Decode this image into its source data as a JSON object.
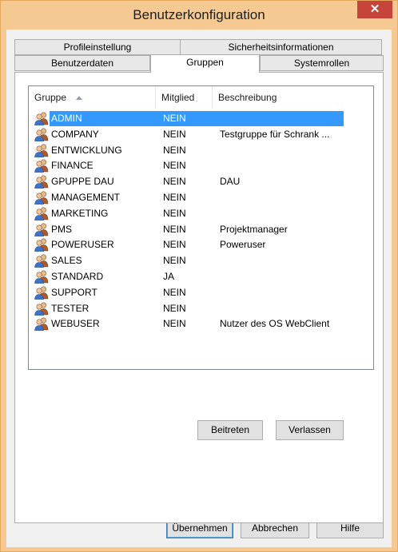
{
  "window": {
    "title": "Benutzerkonfiguration",
    "close_label": "✕"
  },
  "tabs": {
    "row_top": [
      "Profileinstellung",
      "Sicherheitsinformationen"
    ],
    "row_bottom": [
      "Benutzerdaten",
      "Gruppen",
      "Systemrollen"
    ],
    "active": "Gruppen"
  },
  "list": {
    "columns": [
      "Gruppe",
      "Mitglied",
      "Beschreibung"
    ],
    "sort_column": "Gruppe",
    "sort_direction": "ascending",
    "selected_row": "ADMIN",
    "rows": [
      {
        "name": "ADMIN",
        "member": "NEIN",
        "desc": ""
      },
      {
        "name": "COMPANY",
        "member": "NEIN",
        "desc": "Testgruppe für Schrank ..."
      },
      {
        "name": "ENTWICKLUNG",
        "member": "NEIN",
        "desc": ""
      },
      {
        "name": "FINANCE",
        "member": "NEIN",
        "desc": ""
      },
      {
        "name": "GPUPPE DAU",
        "member": "NEIN",
        "desc": "DAU"
      },
      {
        "name": "MANAGEMENT",
        "member": "NEIN",
        "desc": ""
      },
      {
        "name": "MARKETING",
        "member": "NEIN",
        "desc": ""
      },
      {
        "name": "PMS",
        "member": "NEIN",
        "desc": "Projektmanager"
      },
      {
        "name": "POWERUSER",
        "member": "NEIN",
        "desc": "Poweruser"
      },
      {
        "name": "SALES",
        "member": "NEIN",
        "desc": ""
      },
      {
        "name": "STANDARD",
        "member": "JA",
        "desc": ""
      },
      {
        "name": "SUPPORT",
        "member": "NEIN",
        "desc": ""
      },
      {
        "name": "TESTER",
        "member": "NEIN",
        "desc": ""
      },
      {
        "name": "WEBUSER",
        "member": "NEIN",
        "desc": "Nutzer des OS WebClient"
      }
    ],
    "row_icon": "user-group-icon"
  },
  "panel_buttons": {
    "join": "Beitreten",
    "leave": "Verlassen"
  },
  "dialog_buttons": {
    "ok": "Übernehmen",
    "cancel": "Abbrechen",
    "help": "Hilfe"
  },
  "colors": {
    "frame": "#f5c992",
    "close": "#c7443a",
    "selection": "#3399ff"
  }
}
